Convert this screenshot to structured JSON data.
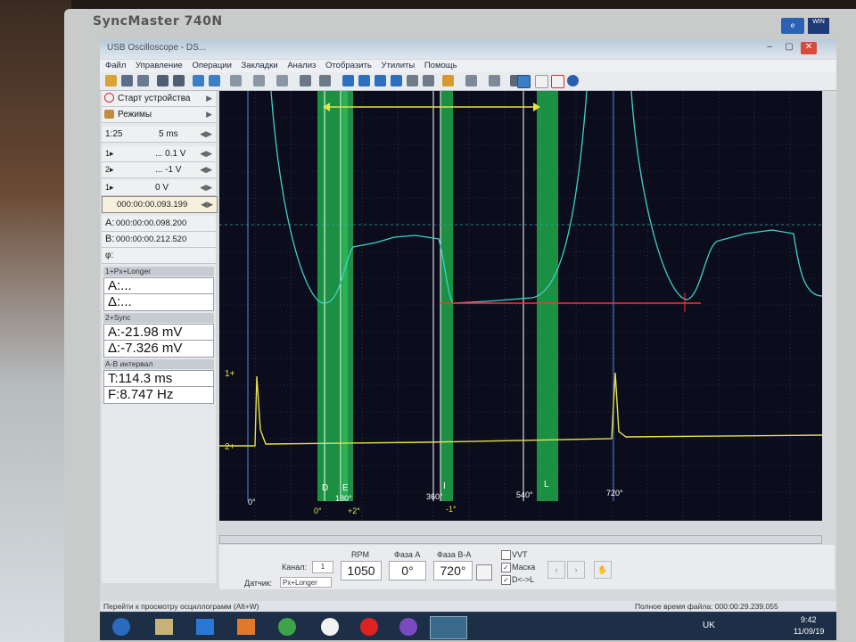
{
  "monitor": {
    "brand": "SyncMaster 740N"
  },
  "window": {
    "title": "USB Oscilloscope - DS..."
  },
  "menu": [
    "Файл",
    "Управление",
    "Операции",
    "Закладки",
    "Анализ",
    "Отобразить",
    "Утилиты",
    "Помощь"
  ],
  "left_panel": {
    "start_label": "Старт устройства",
    "modes_label": "Режимы",
    "zoom": "1:25",
    "timebase": "5 ms",
    "ch1": "... 0.1 V",
    "ch2": "... -1 V",
    "trigger": "0 V",
    "cursor_time": "000:00:00.093.199",
    "cursor_a": "000:00:00.098.200",
    "cursor_b": "000:00:00.212.520",
    "phi": "φ:",
    "section1_title": "1+Px+Longer",
    "section1_a": "A:...",
    "section1_d": "Δ:...",
    "section2_title": "2+Sync",
    "section2_a": "A:-21.98 mV",
    "section2_d": "Δ:-7.326 mV",
    "section3_title": "A-B интервал",
    "section3_t": "T:114.3 ms",
    "section3_f": "F:8.747 Hz"
  },
  "scope": {
    "markers": {
      "d": "D",
      "e": "E",
      "i": "I",
      "l": "L",
      "deg0_top": "0°",
      "deg0_bottom": "0°",
      "deg180": "180°",
      "deg360": "360°",
      "deg540": "540°",
      "deg720": "720°",
      "plus2": "+2°",
      "minus1": "-1°"
    },
    "ch1_label": "1+",
    "ch2_label": "2+"
  },
  "bottom": {
    "channel_label": "Канал:",
    "channel_value": "1",
    "sensor_label": "Датчик:",
    "sensor_value": "Px+Longer",
    "rpm_label": "RPM",
    "rpm_value": "1050",
    "phase_a_label": "Фаза А",
    "phase_a_value": "0°",
    "phase_ba_label": "Фаза В-А",
    "phase_ba_value": "720°",
    "vvt_label": "VVT",
    "mask_label": "Маска",
    "dl_label": "D<->L"
  },
  "status": {
    "hint": "Перейти к просмотру осциллограмм (Alt+W)",
    "file_time": "Полное время файла: 000:00:29.239.055"
  },
  "taskbar": {
    "lang": "UK",
    "clock": "9:42",
    "date": "11/09/19"
  },
  "colors": {
    "scope_bg": "#0b0d1c",
    "ch1_trace": "#3fd1c8",
    "ch2_trace": "#e8e04a",
    "phase_bands": "#1fa84a",
    "cursor_red": "#ff3030"
  }
}
